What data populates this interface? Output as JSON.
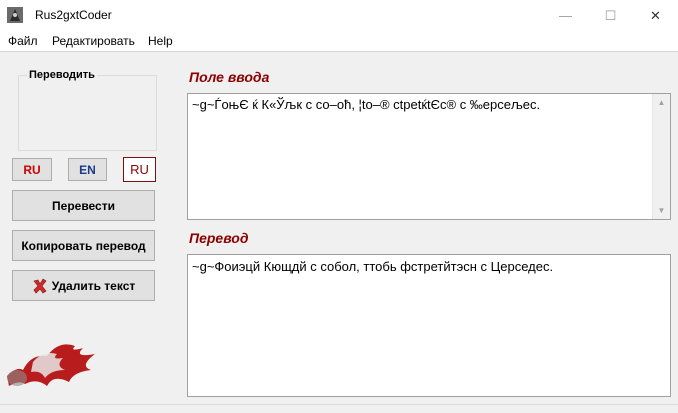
{
  "window": {
    "title": "Rus2gxtCoder",
    "minimize_glyph": "—",
    "maximize_glyph": "☐",
    "close_glyph": "✕",
    "app_icon": "app-logo-icon"
  },
  "menu": {
    "items": [
      {
        "label": "Файл"
      },
      {
        "label": "Редактировать"
      },
      {
        "label": "Help"
      }
    ]
  },
  "left_panel": {
    "group_label": "Переводить",
    "lang_ru_label": "RU",
    "lang_en_label": "EN",
    "current_lang": "RU",
    "translate_label": "Перевести",
    "copy_label": "Копировать перевод",
    "clear_label": "Удалить текст",
    "clear_icon": "red-x-icon",
    "logo_icon": "flame-logo-icon"
  },
  "input_section": {
    "title": "Поле ввода",
    "text": "~g~ЃоњЄ ќ К«Ўљк с со–оћ, ¦to–® ctpetќtЄc® с ‰ерсељес."
  },
  "output_section": {
    "title": "Перевод",
    "text": "~g~Фоиэцй Кющдй с собол, ттобь фстретйтэсн с Церседес."
  },
  "colors": {
    "accent_title": "#8b0000",
    "lang_ru": "#cc0000",
    "lang_en": "#1a3a8a"
  }
}
